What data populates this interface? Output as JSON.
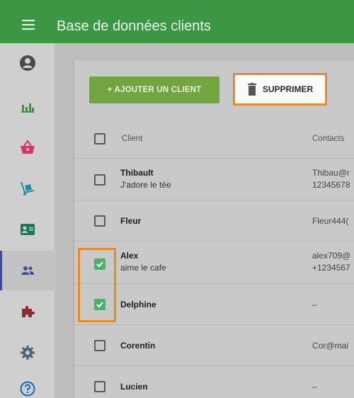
{
  "header": {
    "title": "Base de données clients",
    "menu_icon": "hamburger-icon",
    "background": "#3d9644"
  },
  "sidebar": {
    "items": [
      {
        "name": "account",
        "icon": "account-circle-icon",
        "color": "#4a4a4a"
      },
      {
        "name": "statistics",
        "icon": "bar-chart-icon",
        "color": "#3d9644"
      },
      {
        "name": "orders",
        "icon": "shopping-basket-icon",
        "color": "#d6336c"
      },
      {
        "name": "products",
        "icon": "hand-truck-icon",
        "color": "#1f8fa3"
      },
      {
        "name": "contacts",
        "icon": "contact-card-icon",
        "color": "#1d7a55"
      },
      {
        "name": "customers",
        "icon": "people-icon",
        "color": "#3f4a99",
        "active": true
      },
      {
        "name": "extensions",
        "icon": "puzzle-icon",
        "color": "#8b2e2e"
      },
      {
        "name": "settings",
        "icon": "gear-icon",
        "color": "#4a6578"
      },
      {
        "name": "help",
        "icon": "help-circle-icon",
        "color": "#1565c0"
      }
    ]
  },
  "toolbar": {
    "add_label": "+ AJOUTER UN CLIENT",
    "delete_label": "SUPPRIMER",
    "delete_icon": "trash-icon"
  },
  "table": {
    "columns": [
      "Client",
      "Contacts"
    ],
    "rows": [
      {
        "name": "Thibault",
        "note": "J'adore le tée",
        "contact1": "Thibau@r",
        "contact2": "12345678",
        "checked": false
      },
      {
        "name": "Fleur",
        "note": "",
        "contact1": "Fleur444(",
        "contact2": "",
        "checked": false
      },
      {
        "name": "Alex",
        "note": "aime le cafe",
        "contact1": "alex709@",
        "contact2": "+1234567",
        "checked": true
      },
      {
        "name": "Delphine",
        "note": "",
        "contact1": "–",
        "contact2": "",
        "checked": true
      },
      {
        "name": "Corentin",
        "note": "",
        "contact1": "Cor@mai",
        "contact2": "",
        "checked": false
      },
      {
        "name": "Lucien",
        "note": "",
        "contact1": "–",
        "contact2": "",
        "checked": false
      }
    ]
  },
  "accent_colors": {
    "highlight": "#e98a2a",
    "checkbox_checked": "#4db06a",
    "add_button": "#72a542"
  }
}
